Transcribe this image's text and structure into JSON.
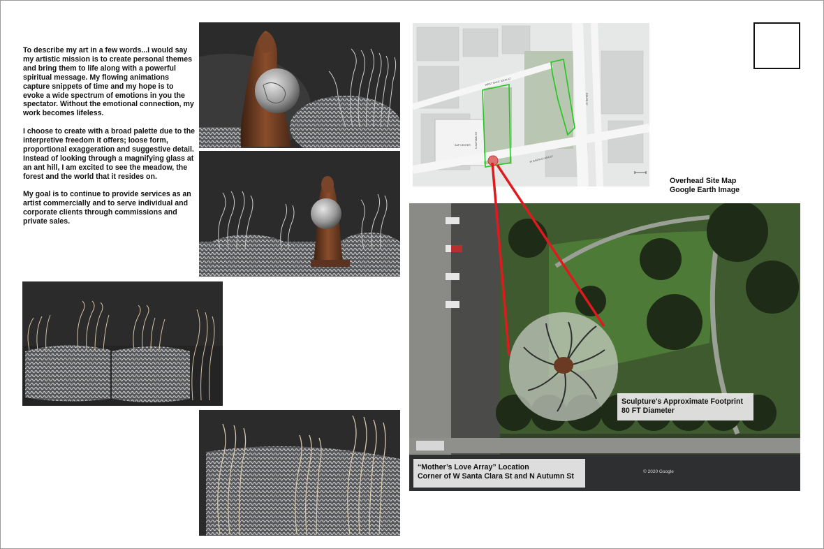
{
  "intro": {
    "p1": "To describe my art in a few words...I would say my artistic mission is to create personal themes and bring them to life along with a powerful spiritual message. My flowing animations capture snippets of time and my hope is to evoke a wide spectrum of emotions in you the spectator. Without the emotional connection, my work becomes lifeless.",
    "p2": "I choose to create with a broad palette due to the interpretive freedom it offers; loose form, proportional exaggeration and suggestive detail. Instead of looking through a magnifying glass at an ant hill, I am excited to see the meadow, the forest and the world that it resides on.",
    "p3": "My goal is to continue to provide services as an artist commercially and to serve individual and corporate clients through commissions and private sales."
  },
  "site_map": {
    "caption_line1": "Overhead Site Map",
    "caption_line2": "Google Earth Image",
    "street_labels": [
      "WEST SAINT JOHN ST",
      "N AUTUMN ST",
      "W SANTA CLARA ST",
      "SAP CENTER",
      "ROUTE 87"
    ]
  },
  "aerial": {
    "footprint_line1": "Sculpture's Approximate Footprint",
    "footprint_line2": "80 FT Diameter",
    "location_line1": "“Mother’s Love Array” Location",
    "location_line2": "Corner of W Santa Clara St and N Autumn St",
    "copyright": "© 2020 Google"
  },
  "colors": {
    "pointer": "#e0191e",
    "boundary": "#22c51f",
    "render_background": "#2b2b2b",
    "bronze": "#6b3a22"
  }
}
